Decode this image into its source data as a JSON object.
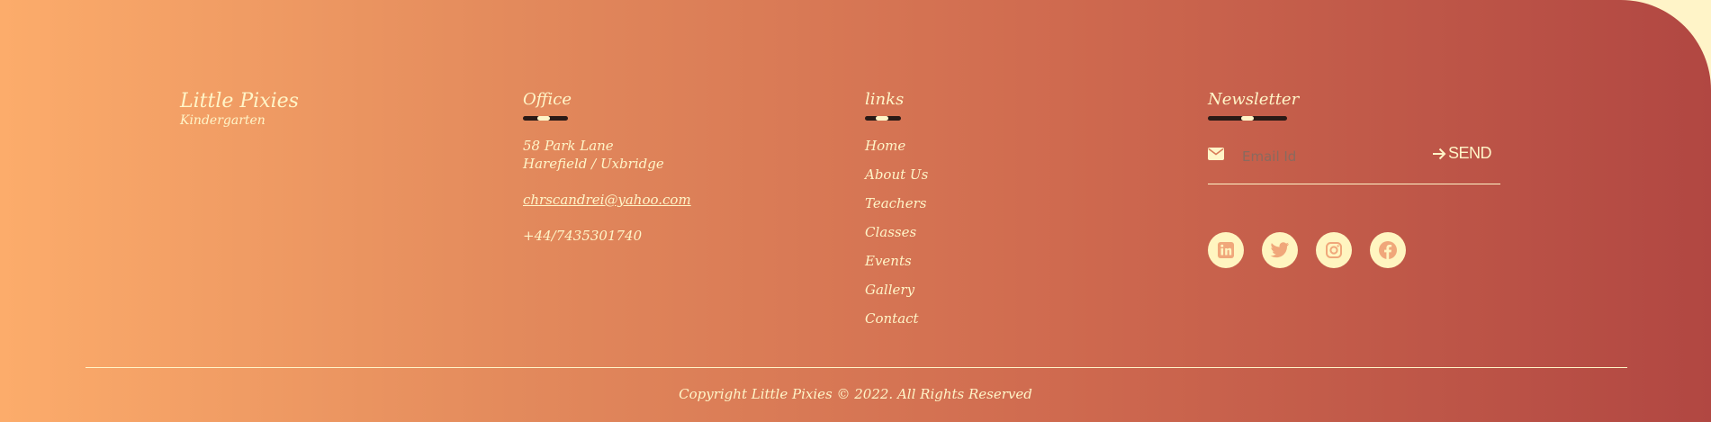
{
  "brand": {
    "title": "Little Pixies",
    "subtitle": "Kindergarten"
  },
  "office": {
    "heading": "Office",
    "address_line1": "58 Park Lane",
    "address_line2": "Harefield / Uxbridge",
    "email": "chrscandrei@yahoo.com",
    "phone": "+44/7435301740"
  },
  "links": {
    "heading": "links",
    "items": [
      "Home",
      "About Us",
      "Teachers",
      "Classes",
      "Events",
      "Gallery",
      "Contact"
    ]
  },
  "newsletter": {
    "heading": "Newsletter",
    "email_placeholder": "Email Id",
    "send_label": "SEND"
  },
  "socials": [
    "linkedin-icon",
    "twitter-icon",
    "instagram-icon",
    "facebook-icon"
  ],
  "copyright": "Copyright Little Pixies © 2022. All Rights Reserved",
  "colors": {
    "gradient_start": "#fcac6b",
    "gradient_end": "#b14742",
    "text": "#fff5c8",
    "icon_bg": "#fff5c0",
    "icon_fg": "#f0a77a"
  }
}
